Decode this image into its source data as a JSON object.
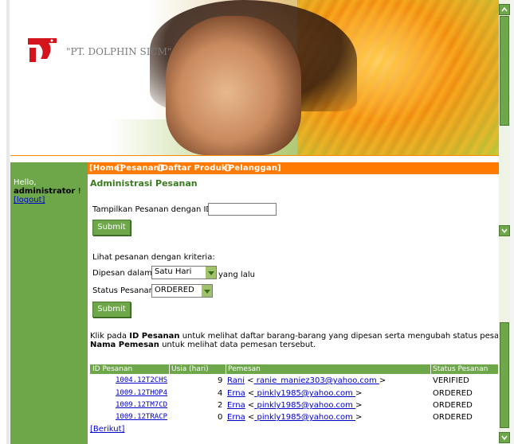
{
  "banner": {
    "company": "\"PT. DOLPHIN SICM\""
  },
  "nav": {
    "items": [
      "[Home]",
      "[Pesanan]",
      "[Daftar Produk]",
      "[Pelanggan]"
    ]
  },
  "user": {
    "greeting": "Hello,",
    "name": "administrator",
    "suffix": "!",
    "logout": "[logout]"
  },
  "main": {
    "title": "Administrasi Pesanan",
    "id_label": "Tampilkan Pesanan dengan ID:",
    "id_value": "",
    "submit1": "Submit",
    "criteria_label": "Lihat pesanan dengan kriteria:",
    "dipesan_label": "Dipesan dalam",
    "dipesan_value": "Satu Hari",
    "dipesan_suffix": "yang lalu",
    "status_label": "Status Pesanan",
    "status_value": "ORDERED",
    "submit2": "Submit",
    "info_part1": "Klik pada ",
    "info_bold1": "ID Pesanan",
    "info_part2": " untuk melihat daftar barang-barang yang dipesan serta mengubah status pesanan. Klik p",
    "info_bold2": "Nama Pemesan",
    "info_part3": " untuk melihat data pemesan tersebut."
  },
  "table": {
    "headers": [
      "ID Pesanan",
      "Usia (hari)",
      "Pemesan",
      "Status Pesanan"
    ],
    "rows": [
      {
        "id": "1004.12T2CHS",
        "age": "9",
        "name": "Rani",
        "email": " ranie_maniez303@yahoo.com ",
        "status": "VERIFIED"
      },
      {
        "id": "1009.12THOP4",
        "age": "4",
        "name": "Erna",
        "email": " pinkly1985@yahoo.com ",
        "status": "ORDERED"
      },
      {
        "id": "1009.12TM7CD",
        "age": "2",
        "name": "Erna",
        "email": " pinkly1985@yahoo.com ",
        "status": "ORDERED"
      },
      {
        "id": "1009.12TRACP",
        "age": "0",
        "name": "Erna",
        "email": " pinkly1985@yahoo.com ",
        "status": "ORDERED"
      }
    ],
    "next": "[Berikut]"
  },
  "colors": {
    "accent": "#6ea64a",
    "nav": "#ff7a00",
    "link": "#0000cc"
  }
}
